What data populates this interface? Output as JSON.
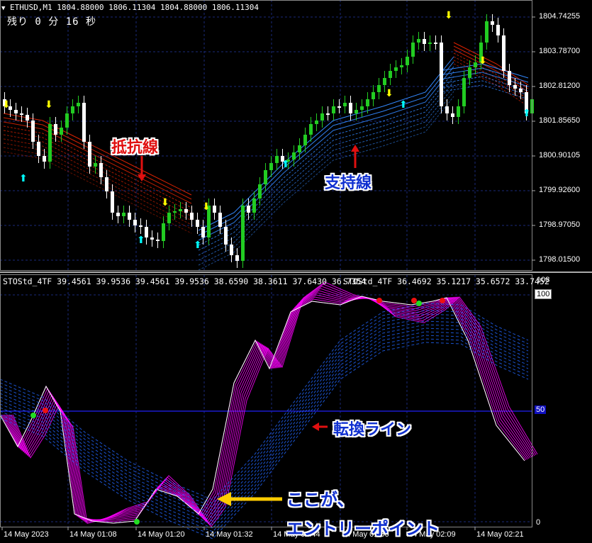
{
  "header": {
    "symbol_line": "ETHUSD,M1  1804.88000 1806.11304 1804.88000 1806.11304",
    "timer": "残り 0 分 16 秒"
  },
  "price_axis": [
    "1804.74255",
    "1803.78700",
    "1802.81200",
    "1801.85650",
    "1800.90105",
    "1799.92600",
    "1798.97050",
    "1798.01500"
  ],
  "indicator_header": {
    "left": "STOStd_4TF 39.4561 39.9536 39.4561 39.9536 38.6590 38.3611 37.6430 36.7354",
    "right": "STOStd_4TF 36.4692 35.1217 35.6572 33.7452"
  },
  "indicator_axis": {
    "top_max": "108",
    "top": "100",
    "mid": "50",
    "bottom": "0"
  },
  "time_axis": [
    "14 May 2023",
    "14 May 01:08",
    "14 May 01:20",
    "14 May 01:32",
    "14 May 01:44",
    "14 May 01:56",
    "14 May 02:09",
    "14 May 02:21"
  ],
  "annotations": {
    "resistance": "抵抗線",
    "support": "支持線",
    "turn_line": "転換ライン",
    "entry_1": "ここが、",
    "entry_2": "エントリーポイント"
  },
  "colors": {
    "background": "#000000",
    "bull": "#22cc22",
    "bear": "#ffffff",
    "resistance": "#dd2200",
    "support": "#3388ff",
    "stoch_fast": "#ff00ff",
    "stoch_slow": "#2266ff",
    "annotation_red": "#e01010",
    "annotation_blue": "#1030d0",
    "arrow_up": "#00ffff",
    "arrow_down": "#ffff00",
    "entry_arrow": "#ffcc00"
  }
}
